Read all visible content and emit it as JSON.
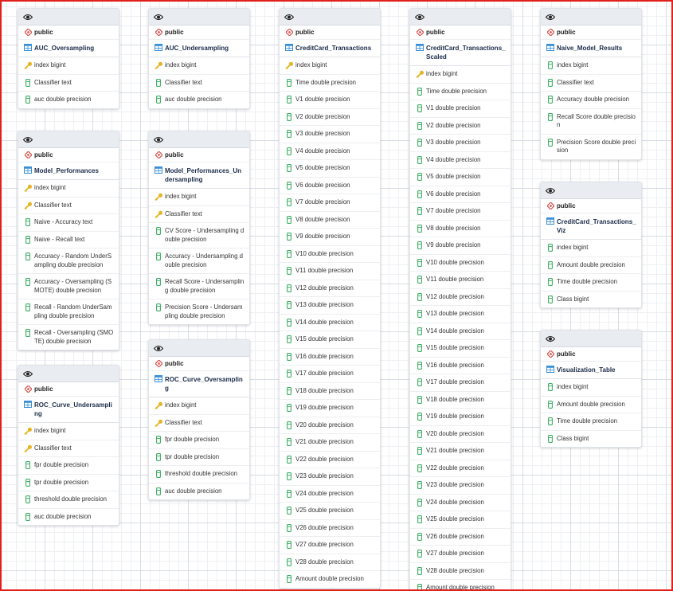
{
  "tables": [
    {
      "schema": "public",
      "name": "AUC_Oversampling",
      "columns": [
        {
          "text": "index bigint",
          "key": true
        },
        {
          "text": "Classifier text",
          "key": false
        },
        {
          "text": "auc double precision",
          "key": false
        }
      ]
    },
    {
      "schema": "public",
      "name": "Model_Performances",
      "columns": [
        {
          "text": "index bigint",
          "key": true
        },
        {
          "text": "Classifier text",
          "key": true
        },
        {
          "text": "Naive - Accuracy text",
          "key": false
        },
        {
          "text": "Naive - Recall text",
          "key": false
        },
        {
          "text": "Accuracy - Random UnderSampling double precision",
          "key": false
        },
        {
          "text": "Accuracy - Oversampling (SMOTE) double precision",
          "key": false
        },
        {
          "text": "Recall - Random UnderSampling double precision",
          "key": false
        },
        {
          "text": "Recall - Oversampling (SMOTE) double precision",
          "key": false
        }
      ]
    },
    {
      "schema": "public",
      "name": "ROC_Curve_Undersampling",
      "columns": [
        {
          "text": "index bigint",
          "key": true
        },
        {
          "text": "Classifier text",
          "key": true
        },
        {
          "text": "fpr double precision",
          "key": false
        },
        {
          "text": "tpr double precision",
          "key": false
        },
        {
          "text": "threshold double precision",
          "key": false
        },
        {
          "text": "auc double precision",
          "key": false
        }
      ]
    },
    {
      "schema": "public",
      "name": "AUC_Undersampling",
      "columns": [
        {
          "text": "index bigint",
          "key": true
        },
        {
          "text": "Classifier text",
          "key": false
        },
        {
          "text": "auc double precision",
          "key": false
        }
      ]
    },
    {
      "schema": "public",
      "name": "Model_Performances_Undersampling",
      "columns": [
        {
          "text": "index bigint",
          "key": true
        },
        {
          "text": "Classifier text",
          "key": true
        },
        {
          "text": "CV Score - Undersampling double precision",
          "key": false
        },
        {
          "text": "Accuracy - Undersampling double precision",
          "key": false
        },
        {
          "text": "Recall Score - Undersampling double precision",
          "key": false
        },
        {
          "text": "Precision Score - Undersampling double precision",
          "key": false
        }
      ]
    },
    {
      "schema": "public",
      "name": "ROC_Curve_Oversampling",
      "columns": [
        {
          "text": "index bigint",
          "key": true
        },
        {
          "text": "Classifier text",
          "key": true
        },
        {
          "text": "fpr double precision",
          "key": false
        },
        {
          "text": "tpr double precision",
          "key": false
        },
        {
          "text": "threshold double precision",
          "key": false
        },
        {
          "text": "auc double precision",
          "key": false
        }
      ]
    },
    {
      "schema": "public",
      "name": "CreditCard_Transactions",
      "columns": [
        {
          "text": "index bigint",
          "key": true
        },
        {
          "text": "Time double precision",
          "key": false
        },
        {
          "text": "V1 double precision",
          "key": false
        },
        {
          "text": "V2 double precision",
          "key": false
        },
        {
          "text": "V3 double precision",
          "key": false
        },
        {
          "text": "V4 double precision",
          "key": false
        },
        {
          "text": "V5 double precision",
          "key": false
        },
        {
          "text": "V6 double precision",
          "key": false
        },
        {
          "text": "V7 double precision",
          "key": false
        },
        {
          "text": "V8 double precision",
          "key": false
        },
        {
          "text": "V9 double precision",
          "key": false
        },
        {
          "text": "V10 double precision",
          "key": false
        },
        {
          "text": "V11 double precision",
          "key": false
        },
        {
          "text": "V12 double precision",
          "key": false
        },
        {
          "text": "V13 double precision",
          "key": false
        },
        {
          "text": "V14 double precision",
          "key": false
        },
        {
          "text": "V15 double precision",
          "key": false
        },
        {
          "text": "V16 double precision",
          "key": false
        },
        {
          "text": "V17 double precision",
          "key": false
        },
        {
          "text": "V18 double precision",
          "key": false
        },
        {
          "text": "V19 double precision",
          "key": false
        },
        {
          "text": "V20 double precision",
          "key": false
        },
        {
          "text": "V21 double precision",
          "key": false
        },
        {
          "text": "V22 double precision",
          "key": false
        },
        {
          "text": "V23 double precision",
          "key": false
        },
        {
          "text": "V24 double precision",
          "key": false
        },
        {
          "text": "V25 double precision",
          "key": false
        },
        {
          "text": "V26 double precision",
          "key": false
        },
        {
          "text": "V27 double precision",
          "key": false
        },
        {
          "text": "V28 double precision",
          "key": false
        },
        {
          "text": "Amount double precision",
          "key": false
        }
      ]
    },
    {
      "schema": "public",
      "name": "CreditCard_Transactions_Scaled",
      "columns": [
        {
          "text": "index bigint",
          "key": true
        },
        {
          "text": "Time double precision",
          "key": false
        },
        {
          "text": "V1 double precision",
          "key": false
        },
        {
          "text": "V2 double precision",
          "key": false
        },
        {
          "text": "V3 double precision",
          "key": false
        },
        {
          "text": "V4 double precision",
          "key": false
        },
        {
          "text": "V5 double precision",
          "key": false
        },
        {
          "text": "V6 double precision",
          "key": false
        },
        {
          "text": "V7 double precision",
          "key": false
        },
        {
          "text": "V8 double precision",
          "key": false
        },
        {
          "text": "V9 double precision",
          "key": false
        },
        {
          "text": "V10 double precision",
          "key": false
        },
        {
          "text": "V11 double precision",
          "key": false
        },
        {
          "text": "V12 double precision",
          "key": false
        },
        {
          "text": "V13 double precision",
          "key": false
        },
        {
          "text": "V14 double precision",
          "key": false
        },
        {
          "text": "V15 double precision",
          "key": false
        },
        {
          "text": "V16 double precision",
          "key": false
        },
        {
          "text": "V17 double precision",
          "key": false
        },
        {
          "text": "V18 double precision",
          "key": false
        },
        {
          "text": "V19 double precision",
          "key": false
        },
        {
          "text": "V20 double precision",
          "key": false
        },
        {
          "text": "V21 double precision",
          "key": false
        },
        {
          "text": "V22 double precision",
          "key": false
        },
        {
          "text": "V23 double precision",
          "key": false
        },
        {
          "text": "V24 double precision",
          "key": false
        },
        {
          "text": "V25 double precision",
          "key": false
        },
        {
          "text": "V26 double precision",
          "key": false
        },
        {
          "text": "V27 double precision",
          "key": false
        },
        {
          "text": "V28 double precision",
          "key": false
        },
        {
          "text": "Amount double precision",
          "key": false
        }
      ]
    },
    {
      "schema": "public",
      "name": "Naive_Model_Results",
      "columns": [
        {
          "text": "index bigint",
          "key": false
        },
        {
          "text": "Classifier text",
          "key": false
        },
        {
          "text": "Accuracy double precision",
          "key": false
        },
        {
          "text": "Recall Score double precision",
          "key": false
        },
        {
          "text": "Precision Score double precision",
          "key": false
        }
      ]
    },
    {
      "schema": "public",
      "name": "CreditCard_Transactions_Viz",
      "columns": [
        {
          "text": "index bigint",
          "key": false
        },
        {
          "text": "Amount double precision",
          "key": false
        },
        {
          "text": "Time double precision",
          "key": false
        },
        {
          "text": "Class bigint",
          "key": false
        }
      ]
    },
    {
      "schema": "public",
      "name": "Visualization_Table",
      "columns": [
        {
          "text": "index bigint",
          "key": false
        },
        {
          "text": "Amount double precision",
          "key": false
        },
        {
          "text": "Time double precision",
          "key": false
        },
        {
          "text": "Class bigint",
          "key": false
        }
      ]
    }
  ],
  "colors": {
    "key": "#e6b422",
    "column": "#3cae62",
    "schema": "#d9534f",
    "table": "#3a8fd6",
    "frame": "#e0201a"
  }
}
